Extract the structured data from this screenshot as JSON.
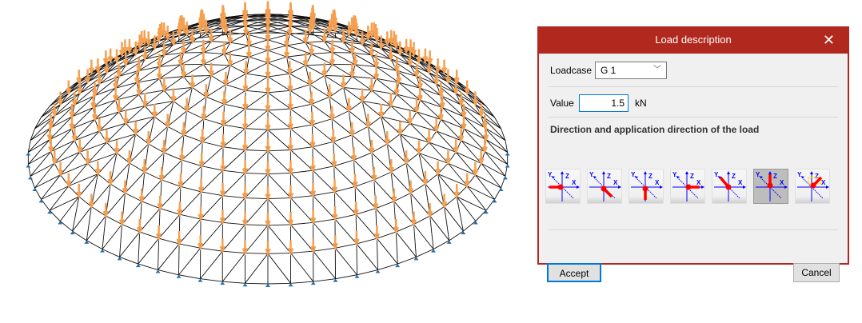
{
  "dialog": {
    "title": "Load description",
    "loadcase_label": "Loadcase",
    "loadcase_value": "G 1",
    "value_label": "Value",
    "value": "1.5",
    "unit": "kN",
    "direction_heading": "Direction and application direction of the load",
    "directions": [
      {
        "name": "positive-x",
        "selected": false
      },
      {
        "name": "positive-y",
        "selected": false
      },
      {
        "name": "positive-z",
        "selected": false
      },
      {
        "name": "negative-x",
        "selected": false
      },
      {
        "name": "negative-y",
        "selected": false
      },
      {
        "name": "negative-z",
        "selected": true
      },
      {
        "name": "arbitrary",
        "selected": false
      }
    ],
    "axis_labels": {
      "x": "X",
      "y": "Y",
      "z": "Z"
    },
    "accept_label": "Accept",
    "cancel_label": "Cancel"
  },
  "colors": {
    "title_bar": "#b0281e",
    "load": "#f5a050",
    "support": "#1f6fb0",
    "axis": "#0000ff",
    "arrow": "#ff0000"
  }
}
